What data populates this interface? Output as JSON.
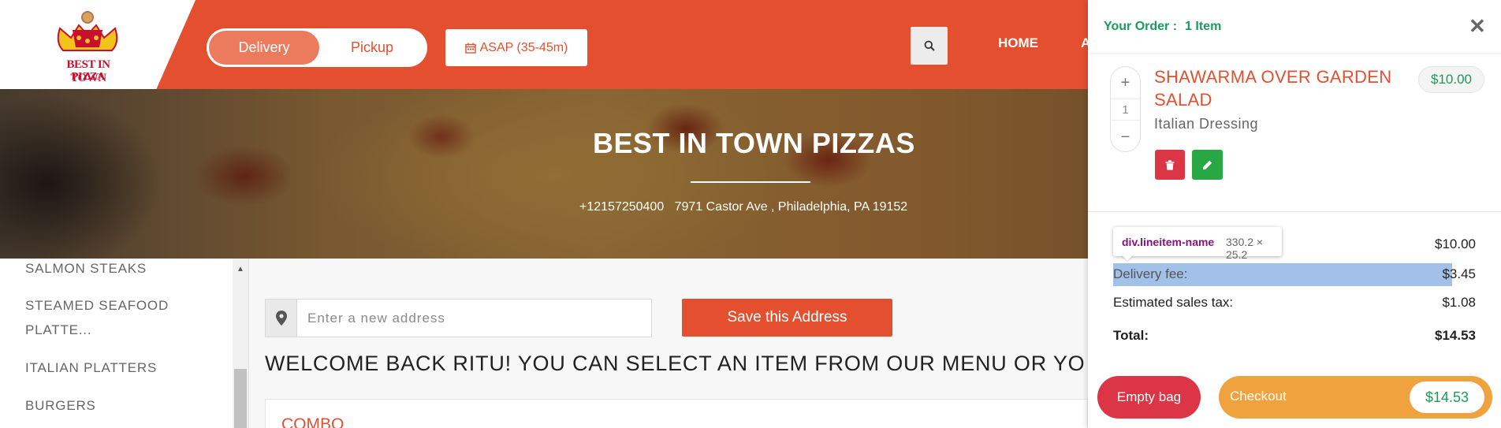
{
  "header": {
    "logo": {
      "line1": "BEST IN TOWN",
      "line2": "PIZZA"
    },
    "order_type": {
      "delivery_label": "Delivery",
      "pickup_label": "Pickup",
      "selected": "Delivery"
    },
    "asap_label": "ASAP (35-45m)",
    "nav": {
      "home": "HOME",
      "next_partial": "A"
    }
  },
  "hero": {
    "title": "BEST IN TOWN PIZZAS",
    "phone": "+12157250400",
    "address": "7971 Castor Ave , Philadelphia, PA 19152"
  },
  "sidebar": {
    "items": [
      {
        "label": "SALMON STEAKS"
      },
      {
        "label": "STEAMED SEAFOOD"
      },
      {
        "label": "PLATTE..."
      },
      {
        "label": "ITALIAN PLATTERS"
      },
      {
        "label": "BURGERS"
      }
    ]
  },
  "main": {
    "address_placeholder": "Enter a new address",
    "save_label": "Save this Address",
    "welcome_text": "WELCOME BACK RITU! YOU CAN SELECT AN ITEM FROM OUR MENU OR YO",
    "section_title": "COMBO"
  },
  "order": {
    "title": "Your Order :",
    "count": "1 Item",
    "item": {
      "name": "SHAWARMA OVER GARDEN SALAD",
      "price": "$10.00",
      "option": "Italian Dressing",
      "quantity": "1"
    },
    "tooltip": {
      "name": "div.lineitem-name",
      "dimensions": "330.2 × 25.2"
    },
    "summary": {
      "subtotal_value": "$10.00",
      "delivery_label": "Delivery fee:",
      "delivery_value": "$3.45",
      "tax_label": "Estimated sales tax:",
      "tax_value": "$1.08",
      "total_label": "Total:",
      "total_value": "$14.53"
    },
    "empty_label": "Empty bag",
    "checkout_label": "Checkout",
    "checkout_total": "$14.53"
  },
  "colors": {
    "brand": "#e4502f",
    "green": "#1a9c5a",
    "danger": "#dc3545",
    "checkout": "#f0a23f"
  }
}
